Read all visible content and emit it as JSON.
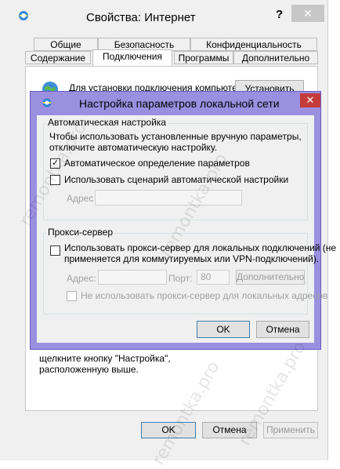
{
  "outer": {
    "title": "Свойства: Интернет",
    "help": "?",
    "close": "✕",
    "tabs_row1": [
      "Общие",
      "Безопасность",
      "Конфиденциальность"
    ],
    "tabs_row2": [
      "Содержание",
      "Подключения",
      "Программы",
      "Дополнительно"
    ],
    "setup_text": "Для установки подключения компьютера",
    "setup_button": "Установить",
    "bottom_text_1": "щелкните кнопку \"Настройка\",",
    "bottom_text_2": "расположенную выше.",
    "ok": "OK",
    "cancel": "Отмена",
    "apply": "Применить"
  },
  "lan": {
    "title": "Настройка параметров локальной сети",
    "close": "✕",
    "auto_group": "Автоматическая настройка",
    "auto_desc_1": "Чтобы использовать установленные вручную параметры,",
    "auto_desc_2": "отключите автоматическую настройку.",
    "auto_detect": "Автоматическое определение параметров",
    "auto_detect_checked": true,
    "auto_script": "Использовать сценарий автоматической настройки",
    "auto_script_checked": false,
    "address_label": "Адрес",
    "proxy_group": "Прокси-сервер",
    "proxy_use_1": "Использовать прокси-сервер для локальных подключений (не",
    "proxy_use_2": "применяется для коммутируемых или VPN-подключений).",
    "proxy_address_label": "Адрес:",
    "port_label": "Порт:",
    "port_value": "80",
    "advanced": "Дополнительно",
    "bypass": "Не использовать прокси-сервер для локальных адресов",
    "ok": "OK",
    "cancel": "Отмена"
  },
  "watermark": "remontka.pro"
}
